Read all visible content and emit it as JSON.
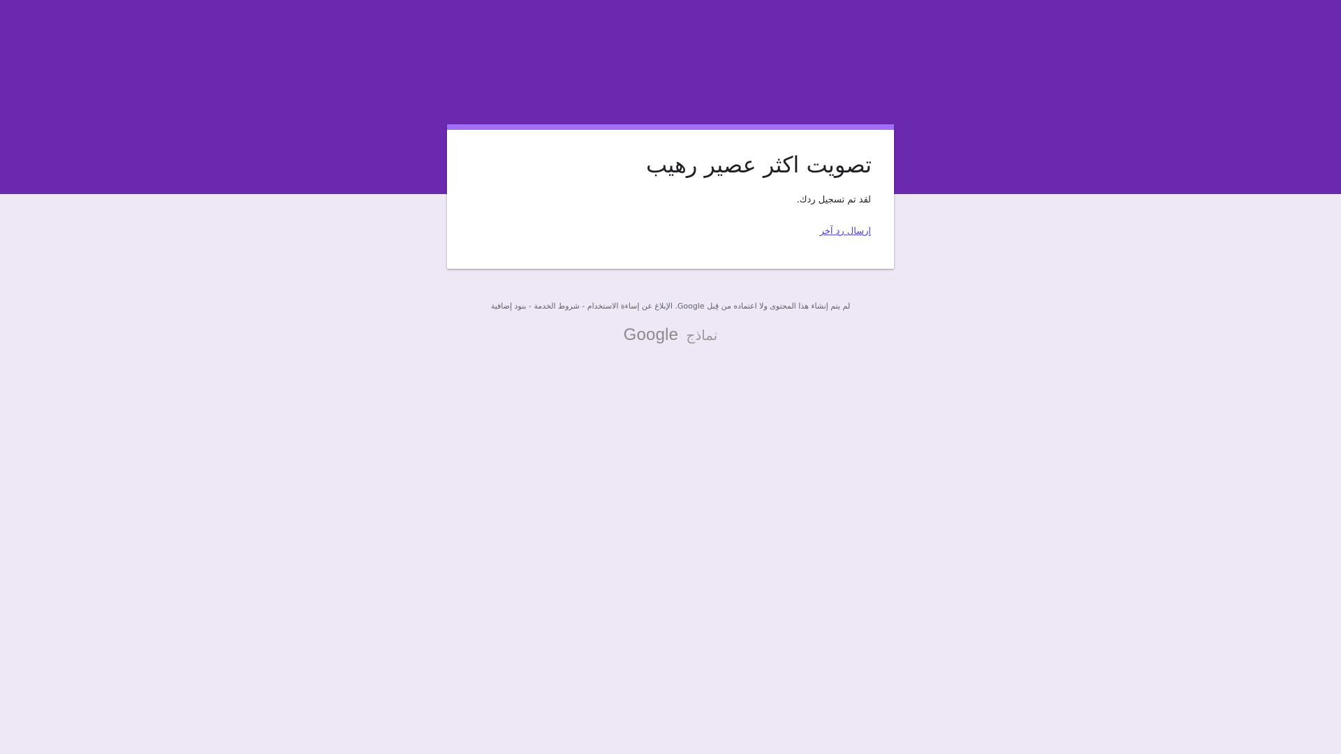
{
  "colors": {
    "banner": "#6b29b0",
    "page_background": "#ede7f6",
    "card_accent": "#a16ef5",
    "link": "#4a40d4"
  },
  "form": {
    "title": "تصويت اكثر عصير رهيب",
    "confirmation_message": "لقد تم تسجيل ردك.",
    "submit_another_link": "إرسال رد آخر"
  },
  "footer": {
    "disclaimer": "لم يتم إنشاء هذا المحتوى ولا اعتماده من قِبل Google.",
    "report_abuse": "الإبلاغ عن إساءة الاستخدام",
    "separator": " - ",
    "terms": "شروط الخدمة",
    "additional_terms": "بنود إضافية"
  },
  "brand": {
    "logo_text": "Google",
    "product_text": "نماذج"
  }
}
